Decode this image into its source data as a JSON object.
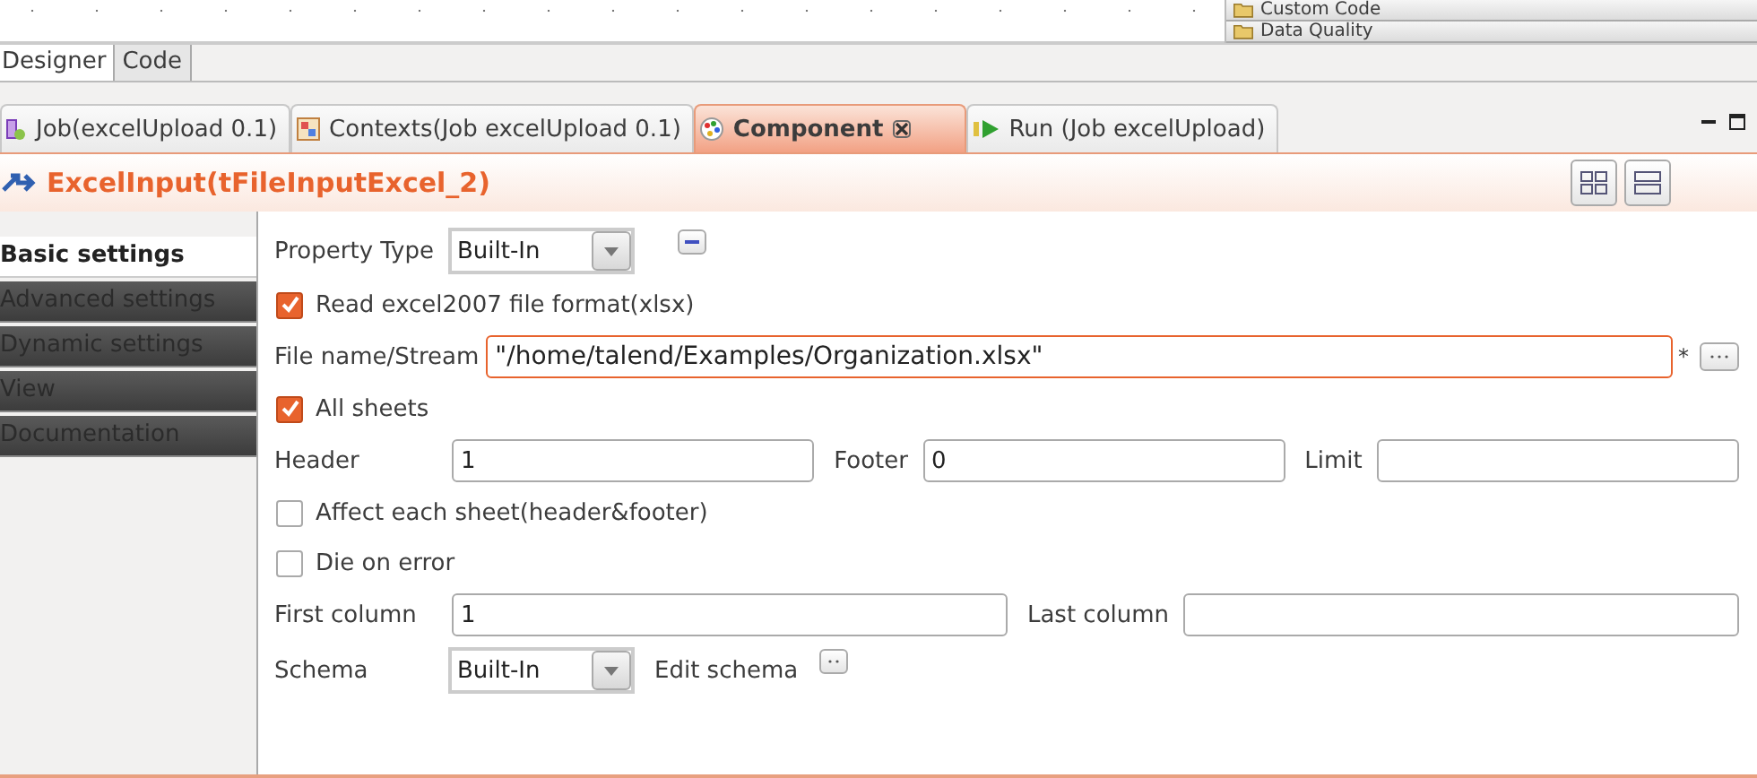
{
  "palette": {
    "items": [
      {
        "label": "Custom Code"
      },
      {
        "label": "Data Quality"
      }
    ]
  },
  "editor_tabs": [
    {
      "label": "Designer",
      "selected": true
    },
    {
      "label": "Code",
      "selected": false
    }
  ],
  "view_tabs": [
    {
      "kind": "job",
      "label": "Job(excelUpload 0.1)",
      "selected": false
    },
    {
      "kind": "contexts",
      "label": "Contexts(Job excelUpload 0.1)",
      "selected": false
    },
    {
      "kind": "component",
      "label": "Component",
      "selected": true
    },
    {
      "kind": "run",
      "label": "Run (Job excelUpload)",
      "selected": false
    }
  ],
  "component_title": "ExcelInput(tFileInputExcel_2)",
  "sections": [
    {
      "label": "Basic settings",
      "selected": true
    },
    {
      "label": "Advanced settings",
      "selected": false
    },
    {
      "label": "Dynamic settings",
      "selected": false
    },
    {
      "label": "View",
      "selected": false
    },
    {
      "label": "Documentation",
      "selected": false
    }
  ],
  "form": [
    {
      "kind": "select",
      "label": "Property Type",
      "value": "Built-In"
    },
    {
      "kind": "checkbox",
      "label": "Read excel2007 file format(xlsx)",
      "checked": true
    },
    {
      "kind": "file",
      "label": "File name/Stream",
      "value": "\"/home/talend/Examples/Organization.xlsx\"",
      "required_mark": "*"
    },
    {
      "kind": "checkbox",
      "label": "All sheets",
      "checked": true
    },
    {
      "kind": "fields",
      "fields": [
        {
          "label": "Header",
          "value": "1"
        },
        {
          "label": "Footer",
          "value": "0"
        },
        {
          "label": "Limit"
        }
      ]
    },
    {
      "kind": "checkbox",
      "label": "Affect each sheet(header&footer)",
      "checked": false
    },
    {
      "kind": "checkbox",
      "label": "Die on error",
      "checked": false
    },
    {
      "kind": "fields",
      "fields": [
        {
          "label": "First column",
          "value": "1"
        },
        {
          "label": "Last column"
        }
      ]
    },
    {
      "kind": "schema",
      "label": "Schema",
      "value": "Built-In",
      "edit_label": "Edit schema"
    }
  ]
}
